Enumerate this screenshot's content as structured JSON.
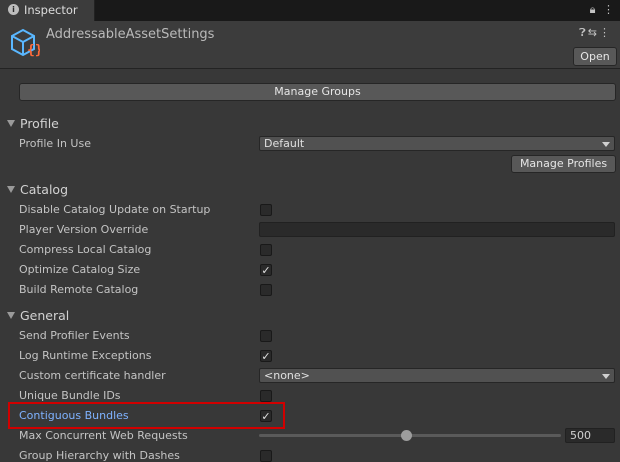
{
  "tab": {
    "title": "Inspector",
    "icon": "info-icon"
  },
  "header": {
    "asset_name": "AddressableAssetSettings",
    "open_label": "Open",
    "icon": "asset-cube-icon"
  },
  "manage_groups_label": "Manage Groups",
  "profile": {
    "section_title": "Profile",
    "profile_in_use_label": "Profile In Use",
    "profile_in_use_value": "Default",
    "manage_profiles_label": "Manage Profiles"
  },
  "catalog": {
    "section_title": "Catalog",
    "disable_update_label": "Disable Catalog Update on Startup",
    "disable_update_checked": false,
    "player_version_label": "Player Version Override",
    "player_version_value": "",
    "compress_label": "Compress Local Catalog",
    "compress_checked": false,
    "optimize_label": "Optimize Catalog Size",
    "optimize_checked": true,
    "build_remote_label": "Build Remote Catalog",
    "build_remote_checked": false
  },
  "general": {
    "section_title": "General",
    "send_profiler_label": "Send Profiler Events",
    "send_profiler_checked": false,
    "log_runtime_label": "Log Runtime Exceptions",
    "log_runtime_checked": true,
    "cert_handler_label": "Custom certificate handler",
    "cert_handler_value": "<none>",
    "unique_bundle_label": "Unique Bundle IDs",
    "unique_bundle_checked": false,
    "contiguous_label": "Contiguous Bundles",
    "contiguous_checked": true,
    "max_requests_label": "Max Concurrent Web Requests",
    "max_requests_value": "500",
    "max_requests_fraction": 0.5,
    "group_dashes_label": "Group Hierarchy with Dashes",
    "group_dashes_checked": false
  },
  "colors": {
    "highlight": "#d10000",
    "link_label": "#7fb2ff",
    "background": "#383838"
  }
}
